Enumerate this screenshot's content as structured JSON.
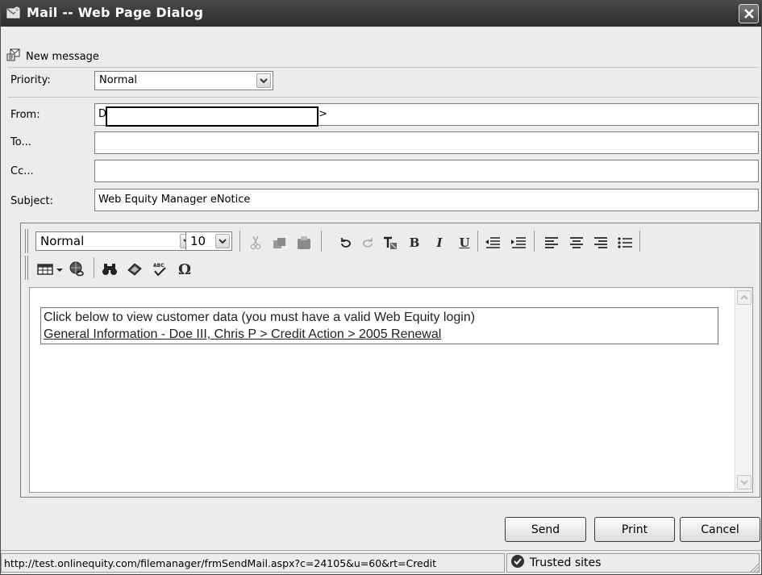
{
  "window": {
    "title": "Mail -- Web Page Dialog"
  },
  "toolbar": {
    "new_message_label": "New message"
  },
  "fields": {
    "priority_label": "Priority:",
    "priority_value": "Normal",
    "from_label": "From:",
    "from_value_start": "D",
    "from_value_end": ">",
    "to_label": "To...",
    "to_value": "",
    "cc_label": "Cc...",
    "cc_value": "",
    "subject_label": "Subject:",
    "subject_value": "Web Equity Manager eNotice"
  },
  "editor": {
    "style_value": "Normal",
    "size_value": "10",
    "bold_label": "B",
    "italic_label": "I",
    "underline_label": "U",
    "body_line1": "Click below to view customer data (you must have a valid Web Equity login)",
    "body_link": "General Information - Doe III, Chris P > Credit Action > 2005 Renewal"
  },
  "buttons": {
    "send": "Send",
    "print": "Print",
    "cancel": "Cancel"
  },
  "status": {
    "url": "http://test.onlinequity.com/filemanager/frmSendMail.aspx?c=24105&u=60&rt=Credit",
    "zone": "Trusted sites"
  },
  "icons": [
    "mail-icon",
    "close-icon",
    "new-message-icon",
    "cut-icon",
    "copy-icon",
    "paste-icon",
    "undo-icon",
    "redo-icon",
    "remove-format-icon",
    "outdent-icon",
    "indent-icon",
    "align-left-icon",
    "align-center-icon",
    "align-right-icon",
    "bullet-list-icon",
    "table-icon",
    "hyperlink-icon",
    "find-icon",
    "spellbook-icon",
    "spellcheck-icon",
    "special-char-icon",
    "trusted-sites-icon"
  ]
}
